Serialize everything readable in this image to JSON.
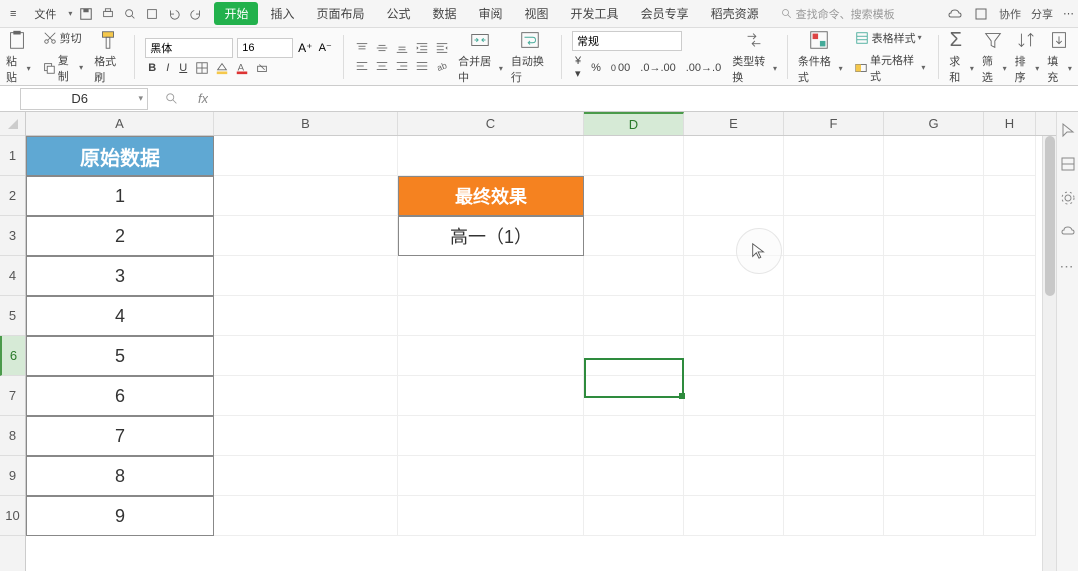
{
  "menubar": {
    "file": "文件",
    "tabs": [
      "开始",
      "插入",
      "页面布局",
      "公式",
      "数据",
      "审阅",
      "视图",
      "开发工具",
      "会员专享",
      "稻壳资源"
    ],
    "active_tab": 0,
    "search_placeholder": "查找命令、搜索模板",
    "collab": "协作",
    "share": "分享"
  },
  "ribbon": {
    "paste": "粘贴",
    "cut": "剪切",
    "copy": "复制",
    "format_painter": "格式刷",
    "font_name": "黑体",
    "font_size": "16",
    "merge_center": "合并居中",
    "wrap_text": "自动换行",
    "num_format": "常规",
    "type_convert": "类型转换",
    "cond_format": "条件格式",
    "table_style": "表格样式",
    "cell_style": "单元格样式",
    "sum": "求和",
    "filter": "筛选",
    "sort": "排序",
    "fill": "填充"
  },
  "namebox": "D6",
  "formula": "",
  "columns": [
    "A",
    "B",
    "C",
    "D",
    "E",
    "F",
    "G",
    "H"
  ],
  "rows": [
    "1",
    "2",
    "3",
    "4",
    "5",
    "6",
    "7",
    "8",
    "9",
    "10"
  ],
  "selected_col": 3,
  "selected_row": 5,
  "colA_header": "原始数据",
  "colA_data": [
    "1",
    "2",
    "3",
    "4",
    "5",
    "6",
    "7",
    "8",
    "9"
  ],
  "c2_header": "最终效果",
  "c3_value": "高一（1）"
}
